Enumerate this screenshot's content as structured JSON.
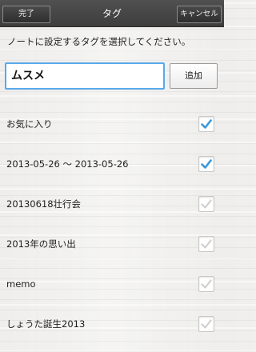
{
  "header": {
    "done_label": "完了",
    "title": "タグ",
    "cancel_label": "キャンセル"
  },
  "instruction": "ノートに設定するタグを選択してください。",
  "tag_input": {
    "value": "ムスメ"
  },
  "add_button_label": "追加",
  "tags": [
    {
      "label": "お気に入り",
      "checked": true
    },
    {
      "label": "2013-05-26 ～ 2013-05-26",
      "checked": true
    },
    {
      "label": "20130618壮行会",
      "checked": false
    },
    {
      "label": "2013年の思い出",
      "checked": false
    },
    {
      "label": "memo",
      "checked": false
    },
    {
      "label": "しょうた誕生2013",
      "checked": false
    }
  ],
  "colors": {
    "checked": "#3a97d6",
    "unchecked": "#cfcfcf",
    "input_focus": "#5aa9e8"
  }
}
